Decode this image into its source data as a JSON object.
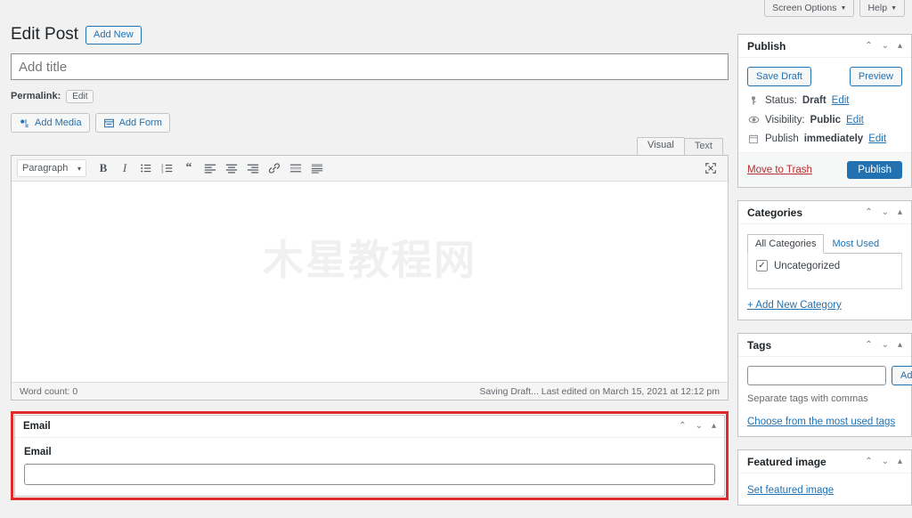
{
  "topbar": {
    "screen_options": "Screen Options",
    "help": "Help",
    "caret": "▼"
  },
  "header": {
    "page_title": "Edit Post",
    "add_new": "Add New"
  },
  "title_field": {
    "placeholder": "Add title",
    "value": ""
  },
  "permalink": {
    "label": "Permalink:",
    "edit": "Edit"
  },
  "media_buttons": {
    "add_media": "Add Media",
    "add_form": "Add Form"
  },
  "editor": {
    "tabs": [
      {
        "label": "Visual",
        "active": true
      },
      {
        "label": "Text",
        "active": false
      }
    ],
    "format_select": "Paragraph",
    "select_caret": "▾",
    "toolbar_icons": [
      "bold-icon",
      "italic-icon",
      "bulleted-list-icon",
      "numbered-list-icon",
      "blockquote-icon",
      "align-left-icon",
      "align-center-icon",
      "align-right-icon",
      "link-icon",
      "insert-read-more-icon",
      "toolbar-toggle-icon"
    ],
    "fullscreen_icon": "distraction-free-icon",
    "watermark": "木星教程网",
    "content": "",
    "word_count": "Word count: 0",
    "save_status": "Saving Draft... Last edited on March 15, 2021 at 12:12 pm"
  },
  "email_box": {
    "title": "Email",
    "field_label": "Email",
    "field_value": "",
    "handles": {
      "up": "⌃",
      "down": "⌄",
      "toggle": "▴"
    },
    "highlight_color": "#e02b2b"
  },
  "sidebar": {
    "publish": {
      "title": "Publish",
      "save_draft": "Save Draft",
      "preview": "Preview",
      "status_label": "Status:",
      "status_value": "Draft",
      "status_edit": "Edit",
      "visibility_label": "Visibility:",
      "visibility_value": "Public",
      "visibility_edit": "Edit",
      "schedule_label": "Publish",
      "schedule_value": "immediately",
      "schedule_edit": "Edit",
      "move_to_trash": "Move to Trash",
      "publish_button": "Publish",
      "accent_color": "#2271b1",
      "trash_color": "#b32d2e",
      "icons": {
        "status": "key-icon",
        "visibility": "visibility-icon",
        "schedule": "calendar-icon"
      }
    },
    "categories": {
      "title": "Categories",
      "tabs": [
        {
          "label": "All Categories",
          "active": true
        },
        {
          "label": "Most Used",
          "active": false
        }
      ],
      "items": [
        {
          "label": "Uncategorized",
          "checked": true
        }
      ],
      "add_new": "+ Add New Category",
      "check_glyph": "✓"
    },
    "tags": {
      "title": "Tags",
      "input_value": "",
      "add_button": "Add",
      "hint": "Separate tags with commas",
      "most_used_link": "Choose from the most used tags"
    },
    "featured_image": {
      "title": "Featured image",
      "set_link": "Set featured image"
    },
    "handles": {
      "up": "⌃",
      "down": "⌄",
      "toggle": "▴"
    }
  }
}
